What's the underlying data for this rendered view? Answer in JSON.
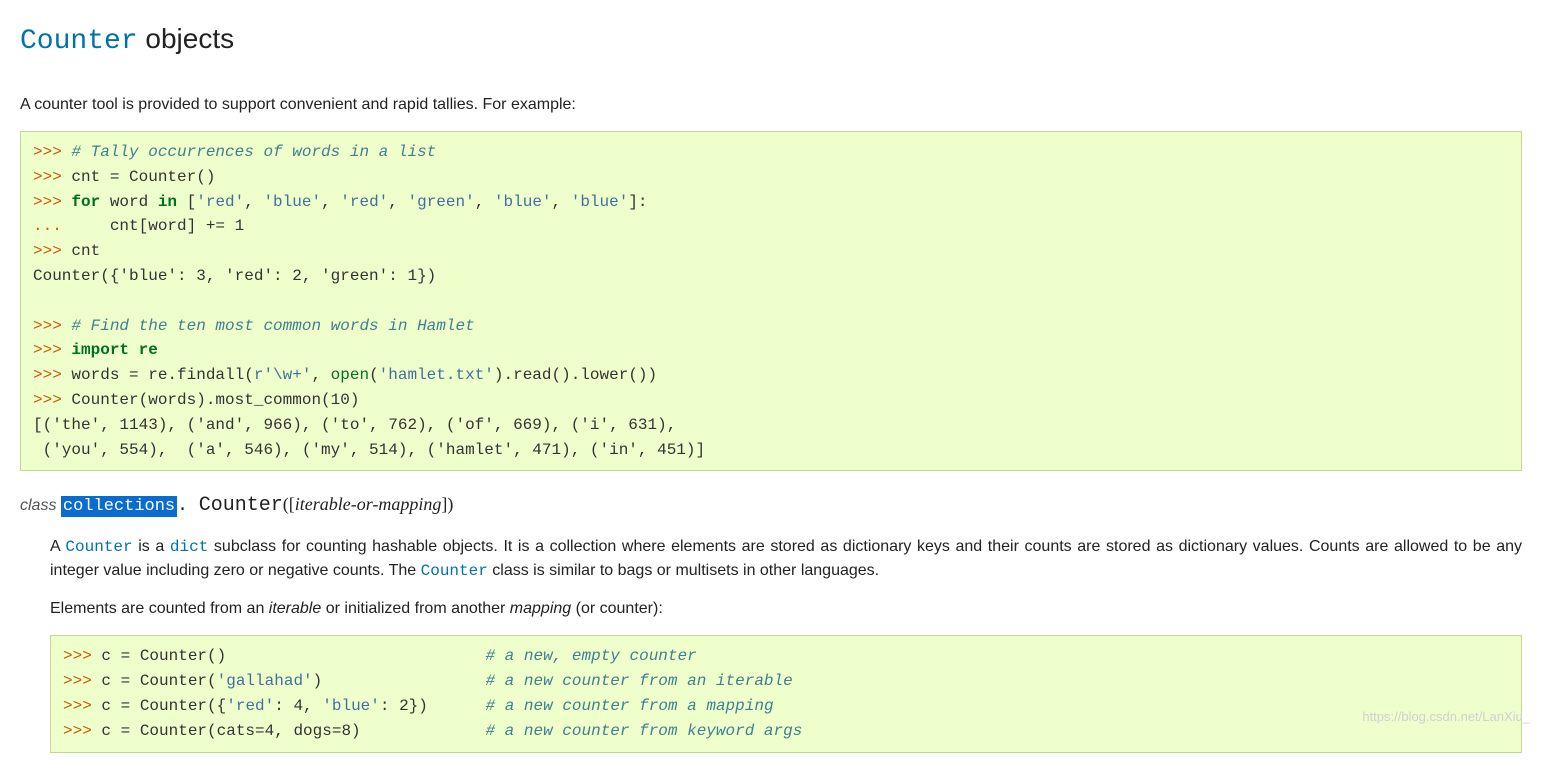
{
  "heading": {
    "code": "Counter",
    "rest": " objects"
  },
  "intro": "A counter tool is provided to support convenient and rapid tallies. For example:",
  "code1": {
    "l1_c": "# Tally occurrences of words in a list",
    "l2": "cnt = Counter()",
    "l3_kw1": "for",
    "l3_mid": " word ",
    "l3_kw2": "in",
    "l3_a": " [",
    "l3_s1": "'red'",
    "l3_s2": "'blue'",
    "l3_s3": "'red'",
    "l3_s4": "'green'",
    "l3_s5": "'blue'",
    "l3_s6": "'blue'",
    "l3_b": "]:",
    "l4": "    cnt[word] += 1",
    "l5": "cnt",
    "l6_out": "Counter({'blue': 3, 'red': 2, 'green': 1})",
    "l8_c": "# Find the ten most common words in Hamlet",
    "l9_kw": "import",
    "l9_mod": " re",
    "l10_a": "words = re.findall(",
    "l10_s1": "r'\\w+'",
    "l10_b": ", ",
    "l10_open": "open",
    "l10_c": "(",
    "l10_s2": "'hamlet.txt'",
    "l10_d": ").read().lower())",
    "l11": "Counter(words).most_common(10)",
    "l12_out": "[('the', 1143), ('and', 966), ('to', 762), ('of', 669), ('i', 631),\n ('you', 554),  ('a', 546), ('my', 514), ('hamlet', 471), ('in', 451)]"
  },
  "sig": {
    "kw": "class ",
    "module": "collections",
    "dot": ". ",
    "name": "Counter",
    "args": "iterable-or-mapping"
  },
  "desc1": {
    "a": "A ",
    "ref1": "Counter",
    "b": " is a ",
    "ref2": "dict",
    "c": " subclass for counting hashable objects. It is a collection where elements are stored as dictionary keys and their counts are stored as dictionary values. Counts are allowed to be any integer value including zero or negative counts. The ",
    "ref3": "Counter",
    "d": " class is similar to bags or multisets in other languages."
  },
  "desc2": {
    "a": "Elements are counted from an ",
    "i1": "iterable",
    "b": " or initialized from another ",
    "i2": "mapping",
    "c": " (or counter):"
  },
  "code2": {
    "l1a": "c = Counter()                           ",
    "l1c": "# a new, empty counter",
    "l2a": "c = Counter(",
    "l2s": "'gallahad'",
    "l2b": ")                 ",
    "l2c": "# a new counter from an iterable",
    "l3a": "c = Counter({",
    "l3s1": "'red'",
    "l3b": ": 4, ",
    "l3s2": "'blue'",
    "l3c": ": 2})      ",
    "l3cc": "# a new counter from a mapping",
    "l4a": "c = Counter(cats=4, dogs=8)             ",
    "l4c": "# a new counter from keyword args"
  },
  "prompt": ">>> ",
  "cont": "... ",
  "watermark": "https://blog.csdn.net/LanXiu_"
}
